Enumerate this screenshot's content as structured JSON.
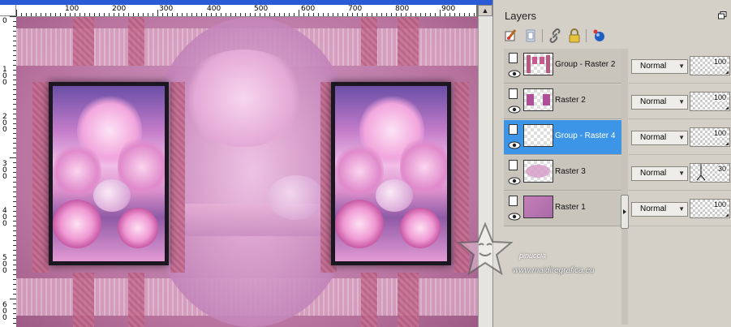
{
  "canvas": {
    "horizontal_ruler_labels": [
      "100",
      "200",
      "300",
      "400",
      "500",
      "600",
      "700",
      "800",
      "900"
    ],
    "vertical_ruler_labels": [
      "0",
      "1 0 0",
      "2 0 0",
      "3 0 0",
      "4 0 0",
      "5 0 0",
      "6 0 0"
    ]
  },
  "layers_panel": {
    "title": "Layers",
    "toolbar_icons": [
      "paintbrush-icon",
      "mask-icon",
      "link-icon",
      "lock-icon",
      "color-balls-icon"
    ],
    "layers": [
      {
        "name": "Group - Raster 2",
        "blend_mode": "Normal",
        "opacity": "100",
        "selected": false,
        "visible": true
      },
      {
        "name": "Raster 2",
        "blend_mode": "Normal",
        "opacity": "100",
        "selected": false,
        "visible": true
      },
      {
        "name": "Group - Raster 4",
        "blend_mode": "Normal",
        "opacity": "100",
        "selected": true,
        "visible": true
      },
      {
        "name": "Raster 3",
        "blend_mode": "Normal",
        "opacity": "30",
        "selected": false,
        "visible": true
      },
      {
        "name": "Raster 1",
        "blend_mode": "Normal",
        "opacity": "100",
        "selected": false,
        "visible": true
      }
    ]
  },
  "watermark": {
    "name": "pinuccia",
    "url": "www.maidiregrafica.eu"
  }
}
